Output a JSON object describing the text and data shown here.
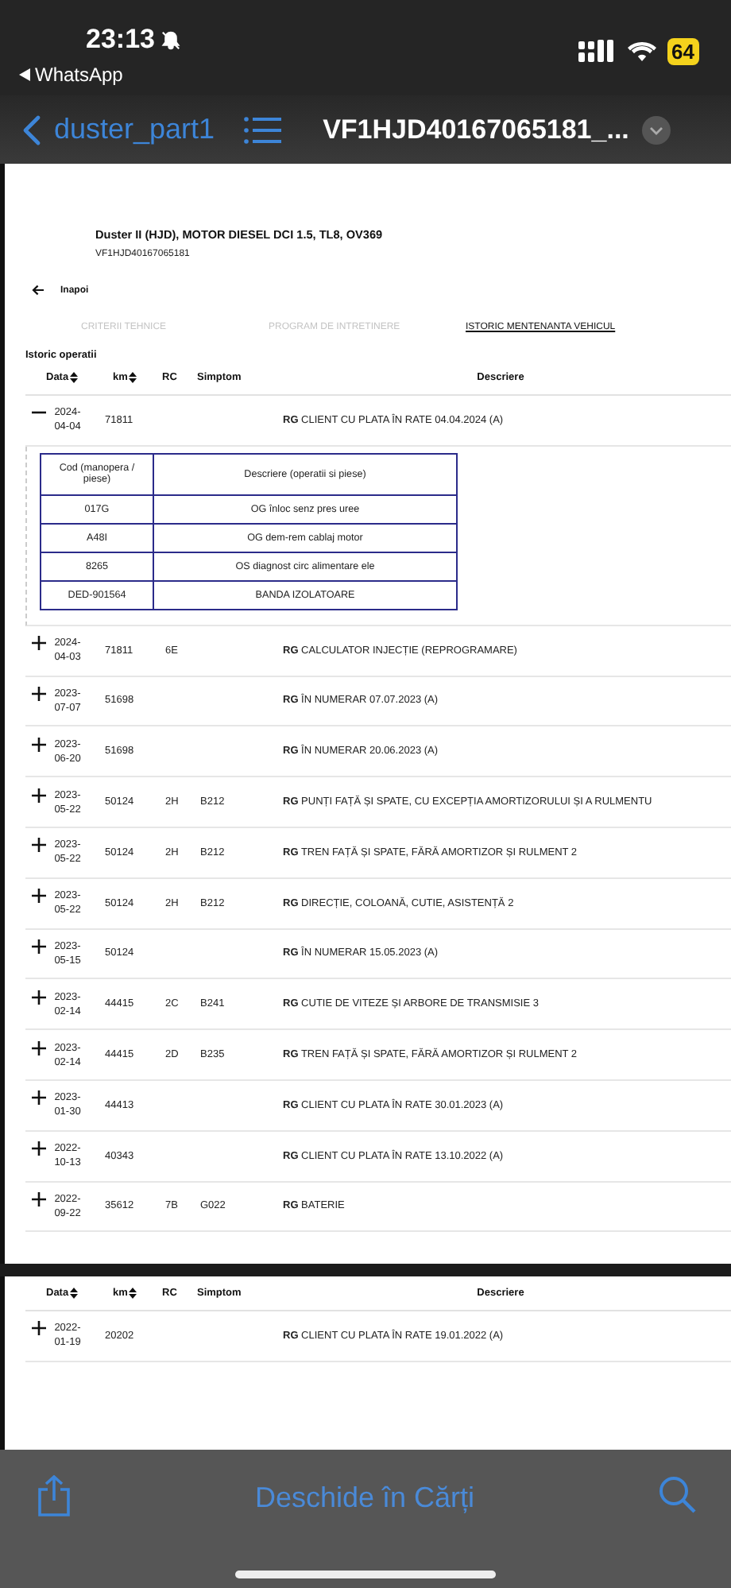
{
  "status_bar": {
    "time": "23:13",
    "back_app": "WhatsApp",
    "battery": "64"
  },
  "nav": {
    "back_label": "duster_part1",
    "title": "VF1HJD40167065181_..."
  },
  "document": {
    "title": "Duster II (HJD), MOTOR DIESEL DCI 1.5, TL8, OV369",
    "vin": "VF1HJD40167065181",
    "back": "Inapoi",
    "tabs": [
      {
        "label": "CRITERII TEHNICE",
        "selected": false
      },
      {
        "label": "PROGRAM DE INTRETINERE",
        "selected": false
      },
      {
        "label": "ISTORIC MENTENANTA VEHICUL",
        "selected": true
      }
    ],
    "section_title": "Istoric operatii",
    "columns": [
      {
        "label": "Data",
        "sortable": true
      },
      {
        "label": "km",
        "sortable": true
      },
      {
        "label": "RC",
        "sortable": false
      },
      {
        "label": "Simptom",
        "sortable": false
      },
      {
        "label": "Descriere",
        "sortable": false
      }
    ],
    "rows": [
      {
        "expanded": true,
        "date": "2024-04-04",
        "km": "71811",
        "rc": "",
        "simptom": "",
        "descriere": "**RG** CLIENT CU PLATA ÎN RATE 04.04.2024 (A)",
        "details": {
          "columns": [
            "Cod (manopera / piese)",
            "Descriere (operatii si piese)"
          ],
          "rows": [
            [
              "017G",
              "OG înloc senz pres uree"
            ],
            [
              "A48I",
              "OG dem-rem cablaj motor"
            ],
            [
              "8265",
              "OS diagnost circ alimentare ele"
            ],
            [
              "DED-901564",
              "BANDA IZOLATOARE"
            ]
          ]
        }
      },
      {
        "expanded": false,
        "date": "2024-04-03",
        "km": "71811",
        "rc": "6E",
        "simptom": "",
        "descriere": "**RG** CALCULATOR INJECȚIE (REPROGRAMARE)"
      },
      {
        "expanded": false,
        "date": "2023-07-07",
        "km": "51698",
        "rc": "",
        "simptom": "",
        "descriere": "**RG** ÎN NUMERAR 07.07.2023 (A)"
      },
      {
        "expanded": false,
        "date": "2023-06-20",
        "km": "51698",
        "rc": "",
        "simptom": "",
        "descriere": "**RG** ÎN NUMERAR 20.06.2023 (A)"
      },
      {
        "expanded": false,
        "date": "2023-05-22",
        "km": "50124",
        "rc": "2H",
        "simptom": "B212",
        "descriere": "**RG** PUNȚI FAȚĂ ȘI SPATE, CU EXCEPȚIA AMORTIZORULUI ȘI A RULMENTU"
      },
      {
        "expanded": false,
        "date": "2023-05-22",
        "km": "50124",
        "rc": "2H",
        "simptom": "B212",
        "descriere": "**RG** TREN FAȚĂ ȘI SPATE, FĂRĂ AMORTIZOR ȘI RULMENT 2"
      },
      {
        "expanded": false,
        "date": "2023-05-22",
        "km": "50124",
        "rc": "2H",
        "simptom": "B212",
        "descriere": "**RG** DIRECȚIE, COLOANĂ, CUTIE, ASISTENȚĂ 2"
      },
      {
        "expanded": false,
        "date": "2023-05-15",
        "km": "50124",
        "rc": "",
        "simptom": "",
        "descriere": "**RG** ÎN NUMERAR 15.05.2023 (A)"
      },
      {
        "expanded": false,
        "date": "2023-02-14",
        "km": "44415",
        "rc": "2C",
        "simptom": "B241",
        "descriere": "**RG** CUTIE DE VITEZE ȘI ARBORE DE TRANSMISIE 3"
      },
      {
        "expanded": false,
        "date": "2023-02-14",
        "km": "44415",
        "rc": "2D",
        "simptom": "B235",
        "descriere": "**RG** TREN FAȚĂ ȘI SPATE, FĂRĂ AMORTIZOR ȘI RULMENT 2"
      },
      {
        "expanded": false,
        "date": "2023-01-30",
        "km": "44413",
        "rc": "",
        "simptom": "",
        "descriere": "**RG** CLIENT CU PLATA ÎN RATE 30.01.2023 (A)"
      },
      {
        "expanded": false,
        "date": "2022-10-13",
        "km": "40343",
        "rc": "",
        "simptom": "",
        "descriere": "**RG** CLIENT CU PLATA ÎN RATE 13.10.2022 (A)"
      },
      {
        "expanded": false,
        "date": "2022-09-22",
        "km": "35612",
        "rc": "7B",
        "simptom": "G022",
        "descriere": "**RG** BATERIE"
      }
    ]
  },
  "page_2": {
    "columns": [
      {
        "label": "Data",
        "sortable": true
      },
      {
        "label": "km",
        "sortable": true
      },
      {
        "label": "RC",
        "sortable": false
      },
      {
        "label": "Simptom",
        "sortable": false
      },
      {
        "label": "Descriere",
        "sortable": false
      }
    ],
    "rows": [
      {
        "expanded": false,
        "date": "2022-01-19",
        "km": "20202",
        "rc": "",
        "simptom": "",
        "descriere": "**RG** CLIENT CU PLATA ÎN RATE 19.01.2022 (A)"
      }
    ]
  },
  "toolbar": {
    "label": "Deschide în Cărți"
  }
}
